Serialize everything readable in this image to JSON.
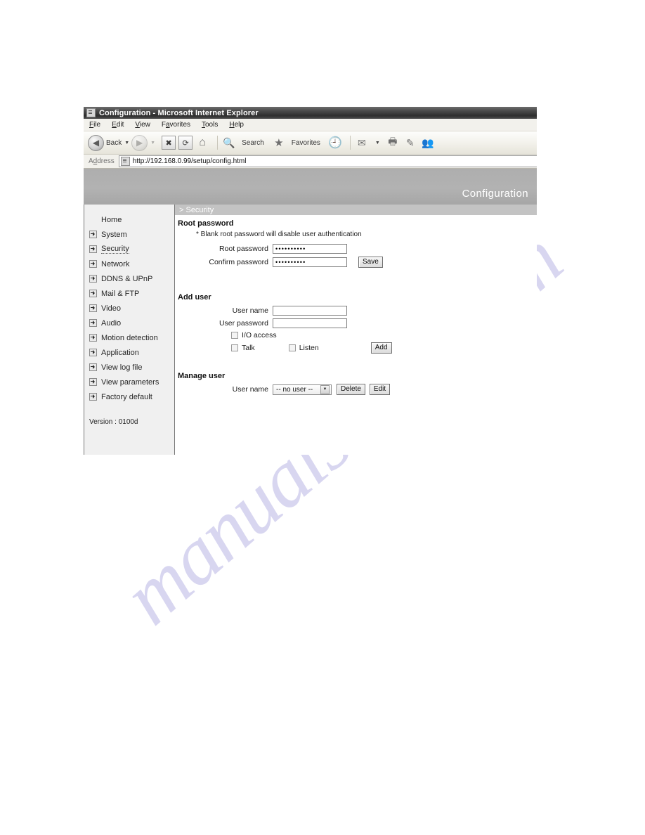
{
  "window": {
    "title": "Configuration - Microsoft Internet Explorer",
    "icon": "ie-page-icon"
  },
  "menubar": {
    "items": [
      {
        "label": "File",
        "accel": "F"
      },
      {
        "label": "Edit",
        "accel": "E"
      },
      {
        "label": "View",
        "accel": "V"
      },
      {
        "label": "Favorites",
        "accel": "a"
      },
      {
        "label": "Tools",
        "accel": "T"
      },
      {
        "label": "Help",
        "accel": "H"
      }
    ]
  },
  "toolbar": {
    "back_label": "Back",
    "forward_label": "",
    "stop_glyph": "✖",
    "refresh_glyph": "⟳",
    "home_glyph": "⌂",
    "search_label": "Search",
    "search_glyph": "🔍",
    "favorites_label": "Favorites",
    "favorites_glyph": "★",
    "history_glyph": "🕘",
    "mail_glyph": "✉",
    "print_glyph": "🖶",
    "edit_glyph": "✎",
    "messenger_glyph": "👥",
    "dropdown_glyph": "▼"
  },
  "address": {
    "label": "Address",
    "url": "http://192.168.0.99/setup/config.html"
  },
  "banner": {
    "title": "Configuration"
  },
  "breadcrumb": {
    "text": "> Security"
  },
  "sidebar": {
    "items": [
      {
        "label": "Home",
        "bullet": false,
        "active": false
      },
      {
        "label": "System",
        "bullet": true,
        "active": false
      },
      {
        "label": "Security",
        "bullet": true,
        "active": true
      },
      {
        "label": "Network",
        "bullet": true,
        "active": false
      },
      {
        "label": "DDNS & UPnP",
        "bullet": true,
        "active": false
      },
      {
        "label": "Mail & FTP",
        "bullet": true,
        "active": false
      },
      {
        "label": "Video",
        "bullet": true,
        "active": false
      },
      {
        "label": "Audio",
        "bullet": true,
        "active": false
      },
      {
        "label": "Motion detection",
        "bullet": true,
        "active": false
      },
      {
        "label": "Application",
        "bullet": true,
        "active": false
      },
      {
        "label": "View log file",
        "bullet": true,
        "active": false
      },
      {
        "label": "View parameters",
        "bullet": true,
        "active": false
      },
      {
        "label": "Factory default",
        "bullet": true,
        "active": false
      }
    ],
    "version": "Version : 0100d"
  },
  "root_password": {
    "heading": "Root password",
    "note": "* Blank root password will disable user authentication",
    "root_label": "Root password",
    "root_value": "••••••••••",
    "confirm_label": "Confirm password",
    "confirm_value": "••••••••••",
    "save_label": "Save"
  },
  "add_user": {
    "heading": "Add user",
    "username_label": "User name",
    "username_value": "",
    "username_placeholder": "",
    "password_label": "User password",
    "password_value": "",
    "password_placeholder": "",
    "io_access_label": "I/O access",
    "talk_label": "Talk",
    "listen_label": "Listen",
    "add_label": "Add"
  },
  "manage_user": {
    "heading": "Manage user",
    "username_label": "User name",
    "selected": "-- no user --",
    "options": [
      "-- no user --"
    ],
    "delete_label": "Delete",
    "edit_label": "Edit"
  },
  "watermark": {
    "text": "manualshive.com"
  },
  "colors": {
    "banner": "#b0b0b0",
    "crumb": "#c3c3c3",
    "sidebar": "#f0f0f0",
    "watermark": "#b9b6e4",
    "titlebar": "#3a3a3a"
  }
}
